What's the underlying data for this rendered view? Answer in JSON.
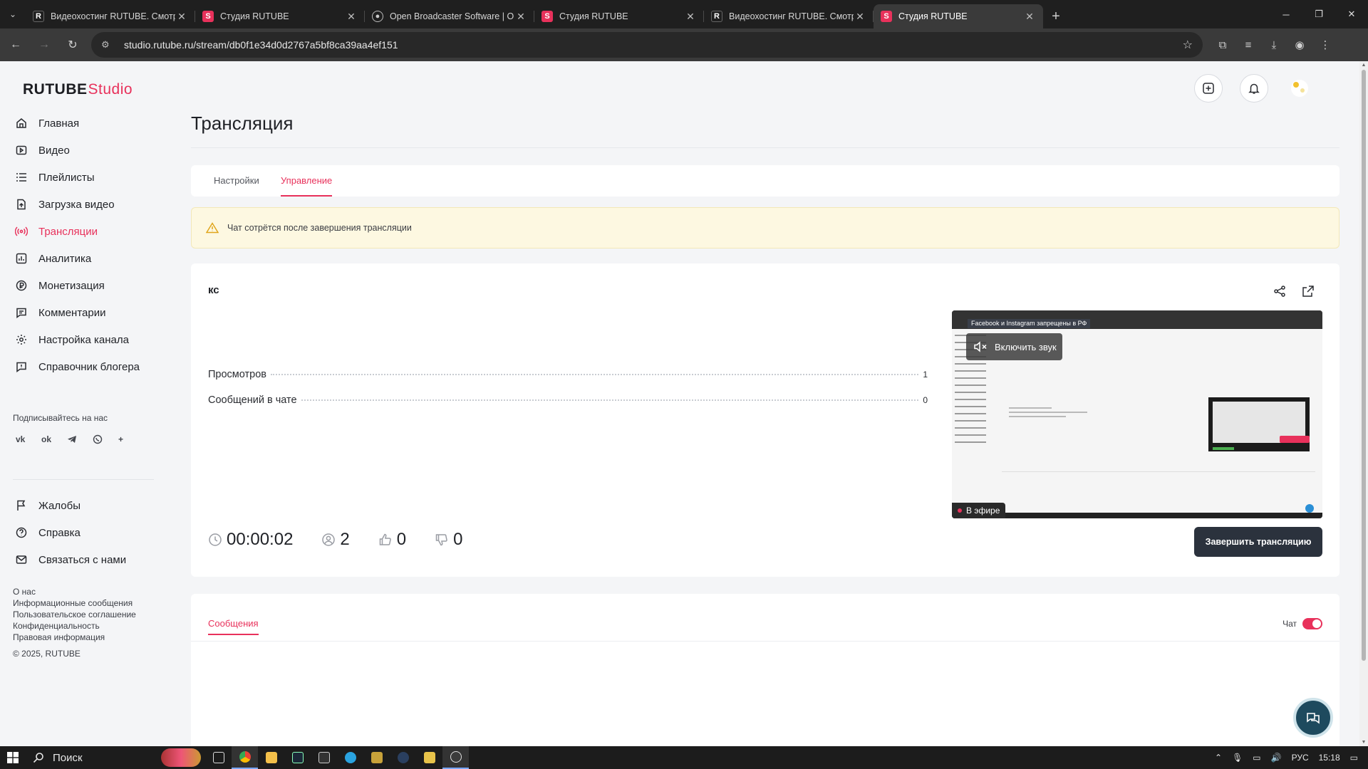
{
  "browser": {
    "tabs": [
      {
        "favicon": "R",
        "title": "Видеохостинг RUTUBE. Смотри",
        "active": false
      },
      {
        "favicon": "S",
        "title": "Студия RUTUBE",
        "active": false
      },
      {
        "favicon": "obs",
        "title": "Open Broadcaster Software | O",
        "active": false
      },
      {
        "favicon": "S",
        "title": "Студия RUTUBE",
        "active": false
      },
      {
        "favicon": "R",
        "title": "Видеохостинг RUTUBE. Смотри",
        "active": false
      },
      {
        "favicon": "S",
        "title": "Студия RUTUBE",
        "active": true
      }
    ],
    "url": "studio.rutube.ru/stream/db0f1e34d0d2767a5bf8ca39aa4ef151"
  },
  "logo": {
    "brand": "RUTUBE",
    "suffix": "Studio"
  },
  "sidebar": {
    "nav": [
      {
        "label": "Главная",
        "icon": "home-icon"
      },
      {
        "label": "Видео",
        "icon": "video-icon"
      },
      {
        "label": "Плейлисты",
        "icon": "playlist-icon"
      },
      {
        "label": "Загрузка видео",
        "icon": "upload-icon"
      },
      {
        "label": "Трансляции",
        "icon": "broadcast-icon",
        "active": true
      },
      {
        "label": "Аналитика",
        "icon": "analytics-icon"
      },
      {
        "label": "Монетизация",
        "icon": "ruble-icon"
      },
      {
        "label": "Комментарии",
        "icon": "comment-icon"
      },
      {
        "label": "Настройка канала",
        "icon": "gear-icon"
      },
      {
        "label": "Справочник блогера",
        "icon": "guide-icon"
      }
    ],
    "subscribe_label": "Подписывайтесь на нас",
    "socials": [
      "vk",
      "ok",
      "telegram",
      "viber",
      "more"
    ],
    "nav2": [
      {
        "label": "Жалобы",
        "icon": "flag-icon"
      },
      {
        "label": "Справка",
        "icon": "help-icon"
      },
      {
        "label": "Связаться с нами",
        "icon": "mail-icon"
      }
    ],
    "footer_links": [
      "О нас",
      "Информационные сообщения",
      "Пользовательское соглашение",
      "Конфиденциальность",
      "Правовая информация"
    ],
    "copyright": "© 2025, RUTUBE"
  },
  "page": {
    "title": "Трансляция",
    "tabs": [
      {
        "label": "Настройки",
        "active": false
      },
      {
        "label": "Управление",
        "active": true
      }
    ],
    "warning": "Чат сотрётся после завершения трансляции",
    "stream": {
      "name": "кс",
      "stats": [
        {
          "label": "Просмотров",
          "value": "1"
        },
        {
          "label": "Сообщений в чате",
          "value": "0"
        }
      ],
      "duration": "00:00:02",
      "viewers": "2",
      "likes": "0",
      "dislikes": "0",
      "preview": {
        "banner": "Facebook и Instagram запрещены в РФ",
        "unmute_label": "Включить звук",
        "status": "В эфире"
      },
      "end_button": "Завершить трансляцию"
    },
    "messages_tab": "Сообщения",
    "chat_label": "Чат",
    "chat_enabled": true
  },
  "taskbar": {
    "search": "Поиск",
    "lang": "РУС",
    "time": "15:18"
  },
  "colors": {
    "accent": "#e8315b",
    "dark_button": "#2b323d",
    "warning_bg": "#fdf8e1"
  }
}
